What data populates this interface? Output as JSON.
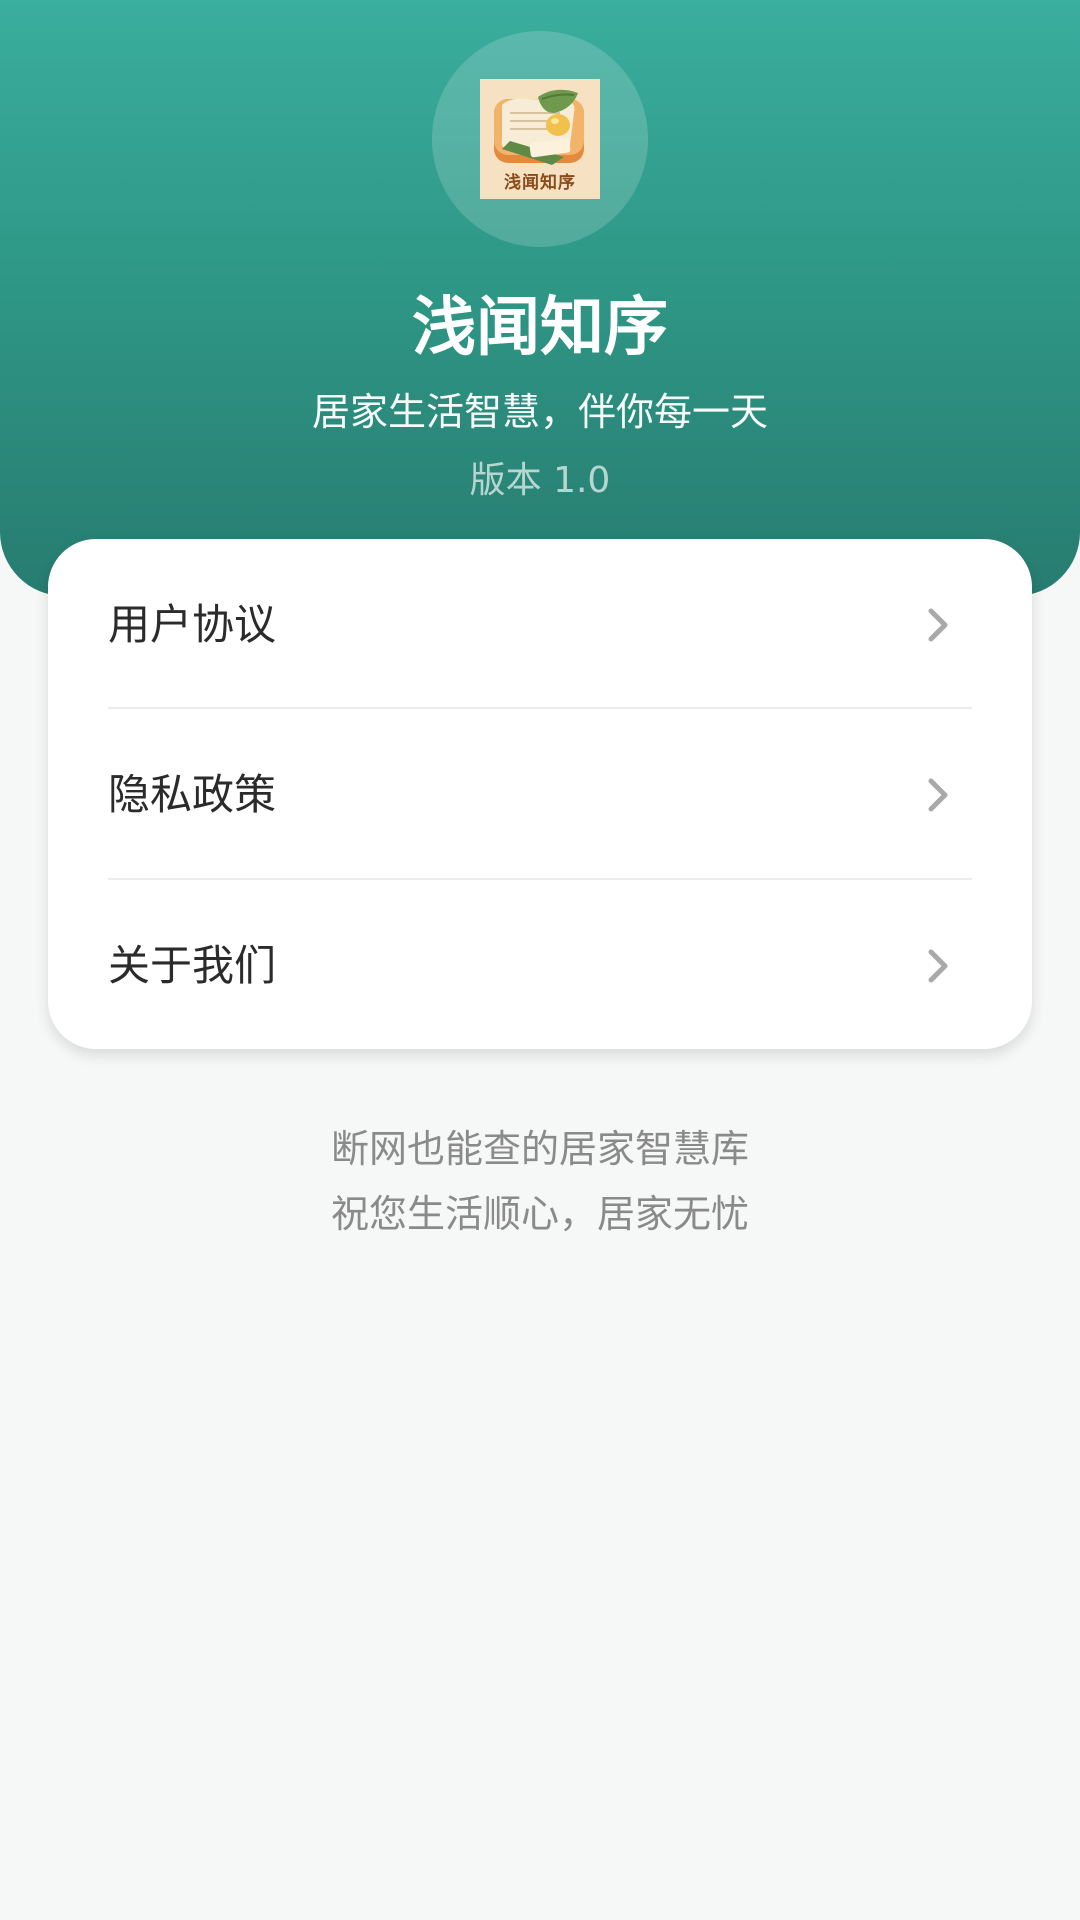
{
  "app": {
    "logo_text": "浅闻知序",
    "title": "浅闻知序",
    "subtitle": "居家生活智慧，伴你每一天",
    "version": "版本 1.0"
  },
  "menu": {
    "items": [
      {
        "label": "用户协议",
        "icon": "chevron-right-icon"
      },
      {
        "label": "隐私政策",
        "icon": "chevron-right-icon"
      },
      {
        "label": "关于我们",
        "icon": "chevron-right-icon"
      }
    ]
  },
  "footer": {
    "line1": "断网也能查的居家智慧库",
    "line2": "祝您生活顺心，居家无忧"
  },
  "colors": {
    "header_top": "#3aae9f",
    "header_bottom": "#277c70",
    "background": "#f6f7f7",
    "card": "#ffffff",
    "text_primary": "#2b2b2b",
    "text_muted": "#8a8a8a",
    "chevron": "#a9a9a9"
  }
}
